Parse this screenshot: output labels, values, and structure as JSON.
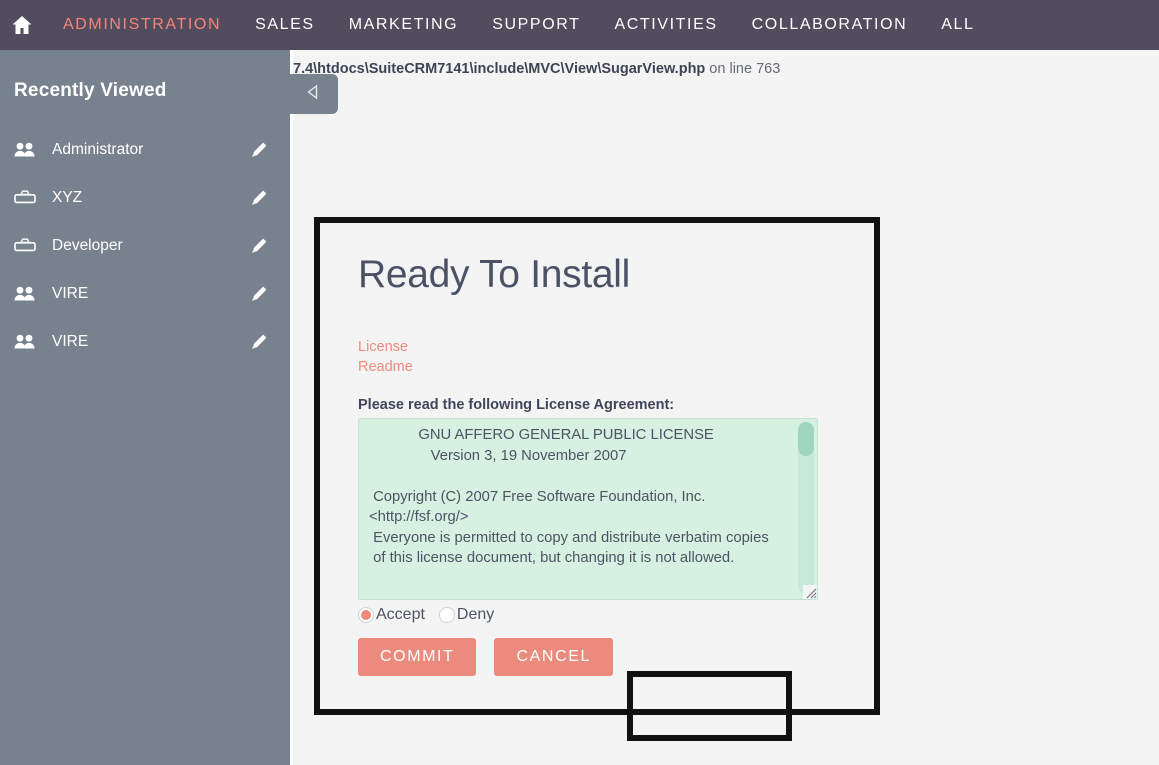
{
  "topnav": {
    "home_icon": "home-icon",
    "items": [
      {
        "label": "ADMINISTRATION",
        "active": true
      },
      {
        "label": "SALES",
        "active": false
      },
      {
        "label": "MARKETING",
        "active": false
      },
      {
        "label": "SUPPORT",
        "active": false
      },
      {
        "label": "ACTIVITIES",
        "active": false
      },
      {
        "label": "COLLABORATION",
        "active": false
      },
      {
        "label": "ALL",
        "active": false
      }
    ],
    "background_color": "#534b5e",
    "active_color": "#f4857a"
  },
  "sidebar": {
    "title": "Recently Viewed",
    "background_color": "#78828f",
    "collapse_icon": "triangle-left-icon",
    "items": [
      {
        "label": "Administrator",
        "icon": "users-icon",
        "edit_icon": "pencil-icon"
      },
      {
        "label": "XYZ",
        "icon": "briefcase-icon",
        "edit_icon": "pencil-icon"
      },
      {
        "label": "Developer",
        "icon": "briefcase-icon",
        "edit_icon": "pencil-icon"
      },
      {
        "label": "VIRE",
        "icon": "users-icon",
        "edit_icon": "pencil-icon"
      },
      {
        "label": "VIRE",
        "icon": "users-icon",
        "edit_icon": "pencil-icon"
      }
    ]
  },
  "main": {
    "php_warning_prefix": "7.4\\htdocs\\SuiteCRM7141\\include\\MVC\\View\\SugarView.php",
    "php_warning_suffix": " on line 763"
  },
  "dialog": {
    "title": "Ready To Install",
    "links": [
      {
        "label": "License"
      },
      {
        "label": "Readme"
      }
    ],
    "agreement_label": "Please read the following License Agreement:",
    "license_text": "            GNU AFFERO GENERAL PUBLIC LICENSE\n               Version 3, 19 November 2007\n\n Copyright (C) 2007 Free Software Foundation, Inc. <http://fsf.org/>\n Everyone is permitted to copy and distribute verbatim copies\n of this license document, but changing it is not allowed.",
    "radios": [
      {
        "label": "Accept",
        "checked": true
      },
      {
        "label": "Deny",
        "checked": false
      }
    ],
    "buttons": [
      {
        "label": "COMMIT"
      },
      {
        "label": "CANCEL"
      }
    ],
    "accent_color": "#ea8b7e",
    "license_bg_color": "#d6f0e2"
  }
}
